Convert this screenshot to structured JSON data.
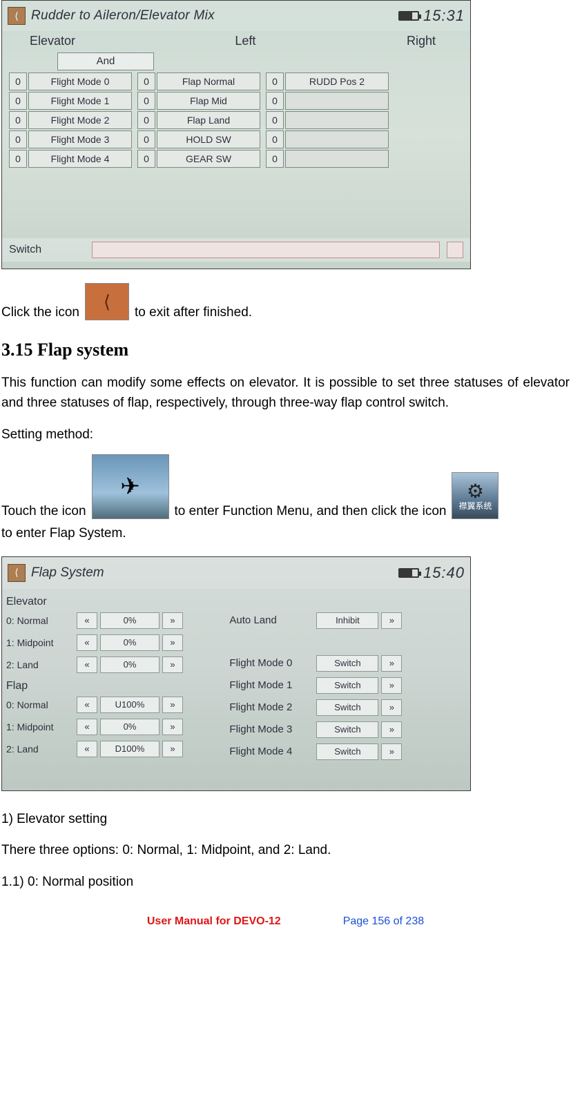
{
  "shot1": {
    "back_glyph": "⟨",
    "title": "Rudder to Aileron/Elevator Mix",
    "battery_icon": "battery-icon",
    "time": "15:31",
    "headers": [
      "Elevator",
      "Left",
      "Right"
    ],
    "and_label": "And",
    "rows": [
      {
        "c1": {
          "box": "0",
          "label": "Flight Mode 0"
        },
        "c2": {
          "box": "0",
          "label": "Flap Normal"
        },
        "c3": {
          "box": "0",
          "label": "RUDD Pos 2"
        }
      },
      {
        "c1": {
          "box": "0",
          "label": "Flight Mode 1"
        },
        "c2": {
          "box": "0",
          "label": "Flap Mid"
        },
        "c3": {
          "box": "0",
          "label": " "
        }
      },
      {
        "c1": {
          "box": "0",
          "label": "Flight Mode 2"
        },
        "c2": {
          "box": "0",
          "label": "Flap Land"
        },
        "c3": {
          "box": "0",
          "label": " "
        }
      },
      {
        "c1": {
          "box": "0",
          "label": "Flight Mode 3"
        },
        "c2": {
          "box": "0",
          "label": "HOLD SW"
        },
        "c3": {
          "box": "0",
          "label": " "
        }
      },
      {
        "c1": {
          "box": "0",
          "label": "Flight Mode 4"
        },
        "c2": {
          "box": "0",
          "label": "GEAR SW"
        },
        "c3": {
          "box": "0",
          "label": " "
        }
      }
    ],
    "bottom_left": "Switch"
  },
  "text": {
    "click_pre": "Click the icon",
    "click_post": "to exit after finished.",
    "section_heading": "3.15 Flap system",
    "flap_intro": "This function can modify some effects on elevator. It is possible to set three statuses of elevator and three statuses of flap, respectively, through three-way flap control switch.",
    "setting_method": "Setting method:",
    "touch_pre": "Touch the icon",
    "touch_mid": "to enter Function Menu, and then click the icon",
    "touch_post": "to enter Flap System.",
    "list1": "1)    Elevator setting",
    "list1_desc": "There three options: 0: Normal, 1: Midpoint, and 2: Land.",
    "list11": "1.1)      0: Normal position"
  },
  "shot2": {
    "title": "Flap System",
    "time": "15:40",
    "left": {
      "elevator_head": "Elevator",
      "flap_head": "Flap",
      "rows_elev": [
        {
          "label": "0: Normal",
          "dec": "«",
          "val": "0%",
          "inc": "»"
        },
        {
          "label": "1: Midpoint",
          "dec": "«",
          "val": "0%",
          "inc": "»"
        },
        {
          "label": "2: Land",
          "dec": "«",
          "val": "0%",
          "inc": "»"
        }
      ],
      "rows_flap": [
        {
          "label": "0: Normal",
          "dec": "«",
          "val": "U100%",
          "inc": "»"
        },
        {
          "label": "1: Midpoint",
          "dec": "«",
          "val": "0%",
          "inc": "»"
        },
        {
          "label": "2: Land",
          "dec": "«",
          "val": "D100%",
          "inc": "»"
        }
      ]
    },
    "right": {
      "rows": [
        {
          "label": "Auto Land",
          "val": "Inhibit",
          "inc": "»"
        },
        {
          "label": "Flight Mode 0",
          "val": "Switch",
          "inc": "»"
        },
        {
          "label": "Flight Mode 1",
          "val": "Switch",
          "inc": "»"
        },
        {
          "label": "Flight Mode 2",
          "val": "Switch",
          "inc": "»"
        },
        {
          "label": "Flight Mode 3",
          "val": "Switch",
          "inc": "»"
        },
        {
          "label": "Flight Mode 4",
          "val": "Switch",
          "inc": "»"
        }
      ]
    }
  },
  "footer": {
    "left": "User Manual for DEVO-12",
    "right": "Page 156 of 238"
  },
  "icons": {
    "exit_glyph": "⟨",
    "plane_glyph": "✈",
    "gear_glyph": "⚙",
    "gear_text": "襟翼系统"
  }
}
